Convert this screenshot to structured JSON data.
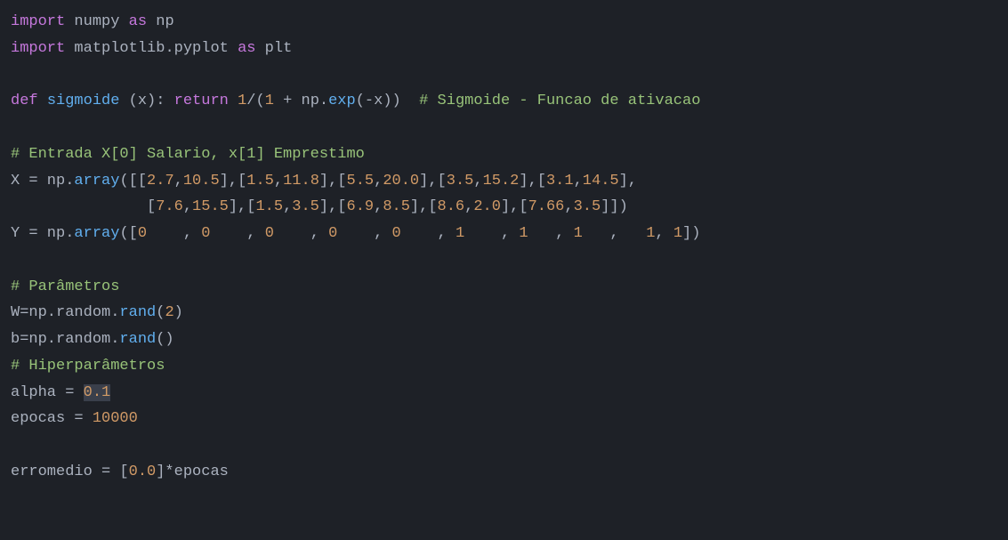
{
  "code": {
    "line1": {
      "import": "import",
      "numpy": "numpy",
      "as": "as",
      "np": "np"
    },
    "line2": {
      "import": "import",
      "matplotlib": "matplotlib.pyplot",
      "as": "as",
      "plt": "plt"
    },
    "line3": {
      "def": "def",
      "fname": "sigmoide",
      "params": " (x): ",
      "return": "return",
      "expr1": " ",
      "num1": "1",
      "slash": "/(",
      "num2": "1",
      "plus": " + np.",
      "exp": "exp",
      "open": "(-x))  ",
      "comment": "# Sigmoide - Funcao de ativacao"
    },
    "line4": {
      "comment": "# Entrada X[0] Salario, x[1] Emprestimo"
    },
    "line5": {
      "prefix": "X = np.",
      "array": "array",
      "data": "([[",
      "n1": "2.7",
      "c1": ",",
      "n2": "10.5",
      "c2": "],[",
      "n3": "1.5",
      "c3": ",",
      "n4": "11.8",
      "c4": "],[",
      "n5": "5.5",
      "c5": ",",
      "n6": "20.0",
      "c6": "],[",
      "n7": "3.5",
      "c7": ",",
      "n8": "15.2",
      "c8": "],[",
      "n9": "3.1",
      "c9": ",",
      "n10": "14.5",
      "c10": "],"
    },
    "line6": {
      "indent": "               [",
      "n1": "7.6",
      "c1": ",",
      "n2": "15.5",
      "c2": "],[",
      "n3": "1.5",
      "c3": ",",
      "n4": "3.5",
      "c4": "],[",
      "n5": "6.9",
      "c5": ",",
      "n6": "8.5",
      "c6": "],[",
      "n7": "8.6",
      "c7": ",",
      "n8": "2.0",
      "c8": "],[",
      "n9": "7.66",
      "c9": ",",
      "n10": "3.5",
      "c10": "]])"
    },
    "line7": {
      "prefix": "Y = np.",
      "array": "array",
      "open": "([",
      "n1": "0",
      "c1": "    , ",
      "n2": "0",
      "c2": "    , ",
      "n3": "0",
      "c3": "    , ",
      "n4": "0",
      "c4": "    , ",
      "n5": "0",
      "c5": "    , ",
      "n6": "1",
      "c6": "    , ",
      "n7": "1",
      "c7": "   , ",
      "n8": "1",
      "c8": "   ,   ",
      "n9": "1",
      "c9": ", ",
      "n10": "1",
      "close": "])"
    },
    "line8": {
      "comment": "# Parâmetros"
    },
    "line9": {
      "prefix": "W=np.random.",
      "rand": "rand",
      "open": "(",
      "num": "2",
      "close": ")"
    },
    "line10": {
      "prefix": "b=np.random.",
      "rand": "rand",
      "parens": "()"
    },
    "line11": {
      "comment": "# Hiperparâmetros"
    },
    "line12": {
      "prefix": "alpha = ",
      "num": "0.1"
    },
    "line13": {
      "prefix": "epocas = ",
      "num": "10000"
    },
    "line14": {
      "prefix": "erromedio = [",
      "num": "0.0",
      "suffix": "]*epocas"
    }
  }
}
